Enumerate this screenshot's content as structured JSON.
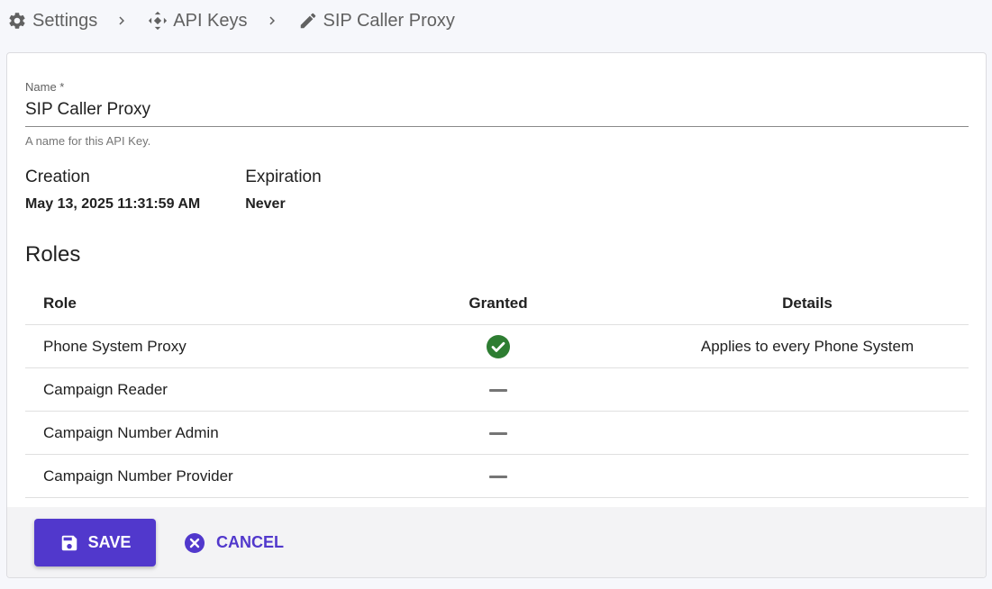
{
  "breadcrumb": {
    "settings": "Settings",
    "api_keys": "API Keys",
    "current": "SIP Caller Proxy",
    "icons": [
      "gear-icon",
      "move-arrows-icon",
      "pencil-icon",
      "chevron-right-icon"
    ]
  },
  "form": {
    "name_label": "Name *",
    "name_value": "SIP Caller Proxy",
    "name_helper": "A name for this API Key."
  },
  "meta": {
    "creation_label": "Creation",
    "creation_value": "May 13, 2025 11:31:59 AM",
    "expiration_label": "Expiration",
    "expiration_value": "Never"
  },
  "roles": {
    "title": "Roles",
    "headers": {
      "role": "Role",
      "granted": "Granted",
      "details": "Details"
    },
    "rows": [
      {
        "role": "Phone System Proxy",
        "granted": true,
        "details": "Applies to every Phone System"
      },
      {
        "role": "Campaign Reader",
        "granted": false,
        "details": ""
      },
      {
        "role": "Campaign Number Admin",
        "granted": false,
        "details": ""
      },
      {
        "role": "Campaign Number Provider",
        "granted": false,
        "details": ""
      }
    ]
  },
  "actions": {
    "save_label": "SAVE",
    "cancel_label": "CANCEL",
    "save_icon": "floppy-disk-icon",
    "cancel_icon": "close-circle-icon"
  },
  "colors": {
    "accent": "#5138cc",
    "granted": "#2e7d32",
    "dash": "#757575"
  }
}
